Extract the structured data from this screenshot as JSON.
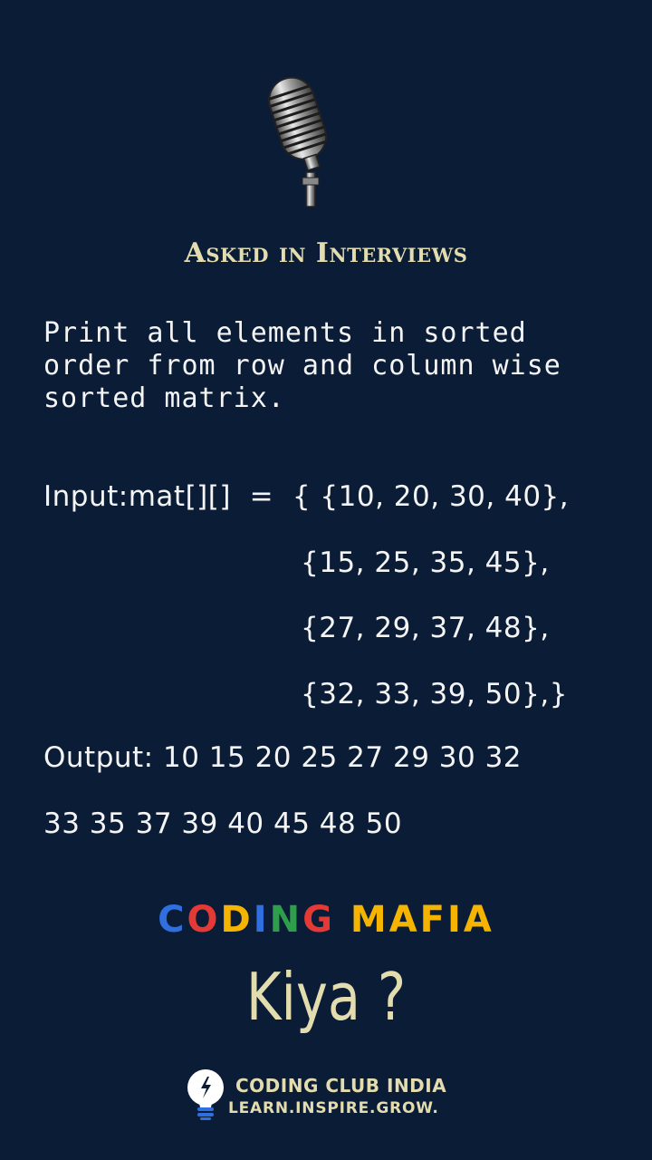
{
  "heading": "Asked in Interviews",
  "question": "Print all elements in sorted order from row and column wise sorted matrix.",
  "input": {
    "label": "Input:mat[][]  =  { {10, 20, 30, 40},",
    "rows": [
      "{15, 25, 35, 45},",
      "{27, 29, 37, 48},",
      "{32, 33, 39, 50},}"
    ]
  },
  "output": {
    "line1": "Output: 10 15 20 25 27 29 30 32",
    "line2": "33 35 37 39 40 45 48 50"
  },
  "brand": {
    "letters": [
      {
        "ch": "C",
        "color": "#2f6fe0"
      },
      {
        "ch": "O",
        "color": "#e53935"
      },
      {
        "ch": "D",
        "color": "#f5b400"
      },
      {
        "ch": "I",
        "color": "#2f6fe0"
      },
      {
        "ch": "N",
        "color": "#2e9e4a"
      },
      {
        "ch": "G",
        "color": "#e53935"
      },
      {
        "ch": " ",
        "color": "#ffffff"
      },
      {
        "ch": "M",
        "color": "#f5b400"
      },
      {
        "ch": "A",
        "color": "#f5b400"
      },
      {
        "ch": "F",
        "color": "#f5b400"
      },
      {
        "ch": "I",
        "color": "#f5b400"
      },
      {
        "ch": "A",
        "color": "#f5b400"
      }
    ]
  },
  "kiya": "Kiya ?",
  "footer": {
    "name": "CODING CLUB INDIA",
    "tagline": "LEARN.INSPIRE.GROW.",
    "logo_icon": "lightbulb-icon"
  },
  "colors": {
    "background": "#0b1c37",
    "accent": "#e3dcae",
    "text": "#f4f4f4"
  }
}
